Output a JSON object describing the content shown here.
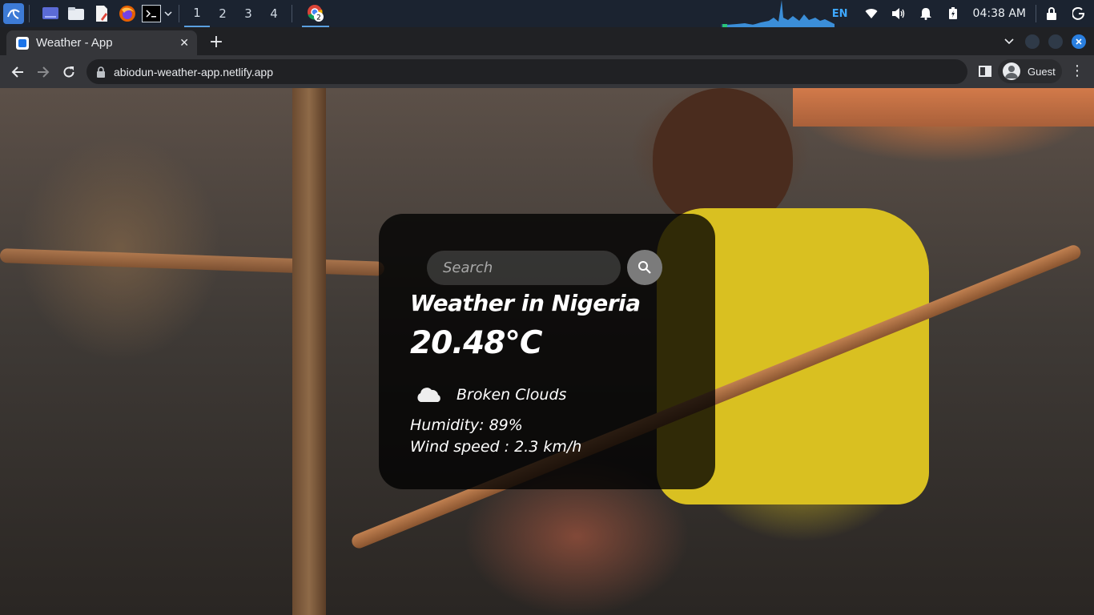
{
  "taskbar": {
    "workspaces": [
      "1",
      "2",
      "3",
      "4"
    ],
    "active_workspace": "1",
    "browser_badge": "2",
    "keyboard_layout": "EN",
    "clock": "04:38 AM",
    "accent_color": "#5aa0e0"
  },
  "browser": {
    "tab": {
      "title": "Weather - App",
      "close_glyph": "✕"
    },
    "new_tab_glyph": "+",
    "url": "abiodun-weather-app.netlify.app",
    "profile_label": "Guest",
    "menu_glyph": "⋮",
    "window_controls": [
      "minimize",
      "maximize",
      "close"
    ],
    "icons": [
      "back-icon",
      "forward-icon",
      "reload-icon",
      "lock-icon",
      "side-panel-icon",
      "avatar-icon",
      "chevron-down-icon"
    ]
  },
  "weather": {
    "search": {
      "placeholder": "Search",
      "value": ""
    },
    "city_heading": "Weather in Nigeria",
    "temperature": "20.48°C",
    "description": "Broken Clouds",
    "icon": "cloud-icon",
    "humidity": "Humidity: 89%",
    "wind": "Wind speed : 2.3 km/h"
  }
}
